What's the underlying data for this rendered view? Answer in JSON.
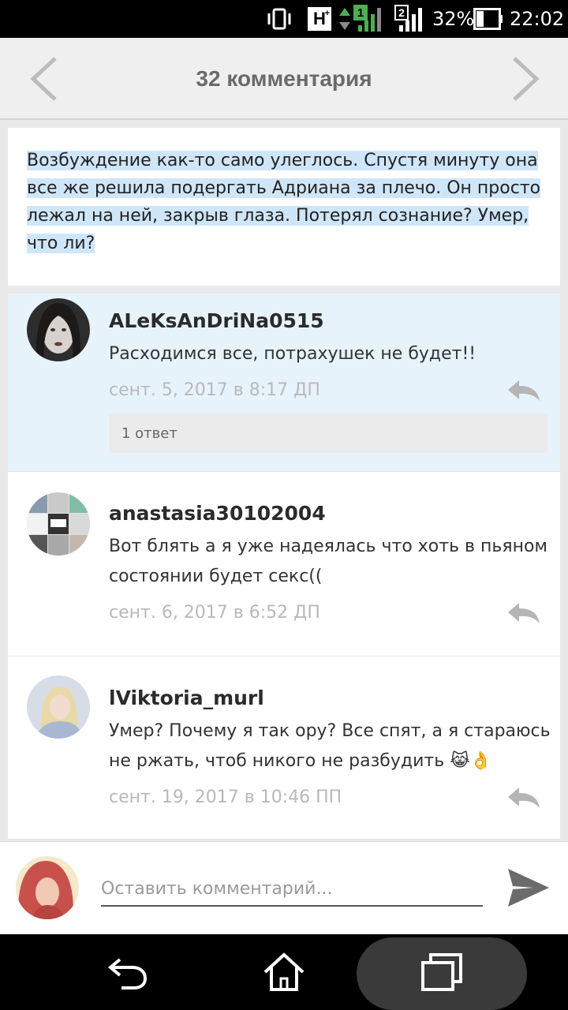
{
  "status_bar": {
    "network_label": "H",
    "network_sup": "+",
    "sim1_badge": "1",
    "sim2_badge": "2",
    "battery": "32%",
    "time": "22:02"
  },
  "header": {
    "title": "32 комментария",
    "prev_icon": "chevron-left-icon",
    "next_icon": "chevron-right-icon"
  },
  "excerpt": {
    "text": "Возбуждение как-то само улеглось. Спустя минуту она все же решила подергать Адриана за плечо. Он просто лежал на ней, закрыв глаза. Потерял сознание? Умер, что ли?"
  },
  "comments": [
    {
      "author": "ALeKsAnDriNa0515",
      "text": "Расходимся все, потрахушек не будет!!",
      "time": "сент. 5, 2017 в 8:17 ДП",
      "replies_label": "1 ответ",
      "highlighted": true
    },
    {
      "author": "anastasia30102004",
      "text": "Вот блять а я уже надеялась что хоть в пьяном состоянии будет секс((",
      "time": "сент. 6, 2017 в 6:52 ДП"
    },
    {
      "author": "lViktoria_murl",
      "text": "Умер? Почему я так ору? Все спят, а я стараюсь не ржать, чтоб никого не разбудить 😹👌",
      "time": "сент. 19, 2017 в 10:46 ПП"
    }
  ],
  "composer": {
    "placeholder": "Оставить комментарий..."
  },
  "colors": {
    "highlight_bg": "#e6f3fb",
    "selection_bg": "#cfe6f8",
    "timestamp": "#b9b9b9"
  }
}
